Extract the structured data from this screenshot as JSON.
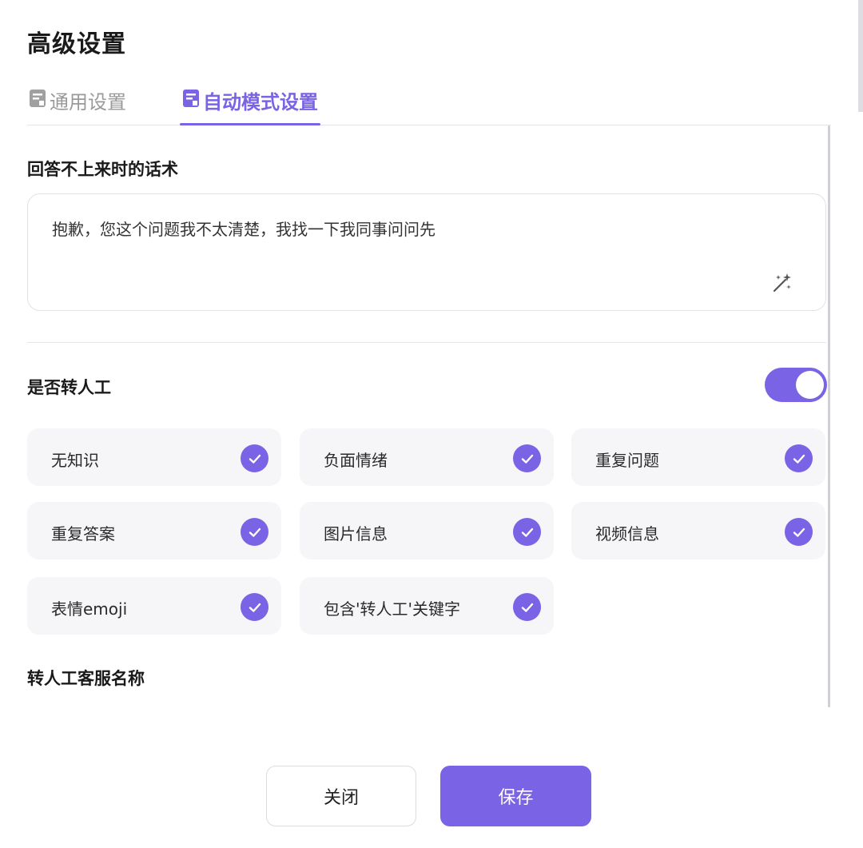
{
  "dialog": {
    "title": "高级设置"
  },
  "tabs": [
    {
      "label": "通用设置",
      "active": false
    },
    {
      "label": "自动模式设置",
      "active": true
    }
  ],
  "fallback": {
    "label": "回答不上来时的话术",
    "value": "抱歉，您这个问题我不太清楚，我找一下我同事问问先"
  },
  "transfer": {
    "label": "是否转人工",
    "enabled": true,
    "options": [
      {
        "label": "无知识",
        "checked": true
      },
      {
        "label": "负面情绪",
        "checked": true
      },
      {
        "label": "重复问题",
        "checked": true
      },
      {
        "label": "重复答案",
        "checked": true
      },
      {
        "label": "图片信息",
        "checked": true
      },
      {
        "label": "视频信息",
        "checked": true
      },
      {
        "label": "表情emoji",
        "checked": true
      },
      {
        "label": "包含'转人工'关键字",
        "checked": true
      }
    ]
  },
  "agent_name": {
    "label": "转人工客服名称"
  },
  "footer": {
    "close_label": "关闭",
    "save_label": "保存"
  },
  "colors": {
    "accent": "#7a63e4",
    "inactive_tab": "#9a9a9a"
  },
  "icons": {
    "tab": "document-icon",
    "assist": "magic-wand-icon",
    "check": "check-icon"
  }
}
